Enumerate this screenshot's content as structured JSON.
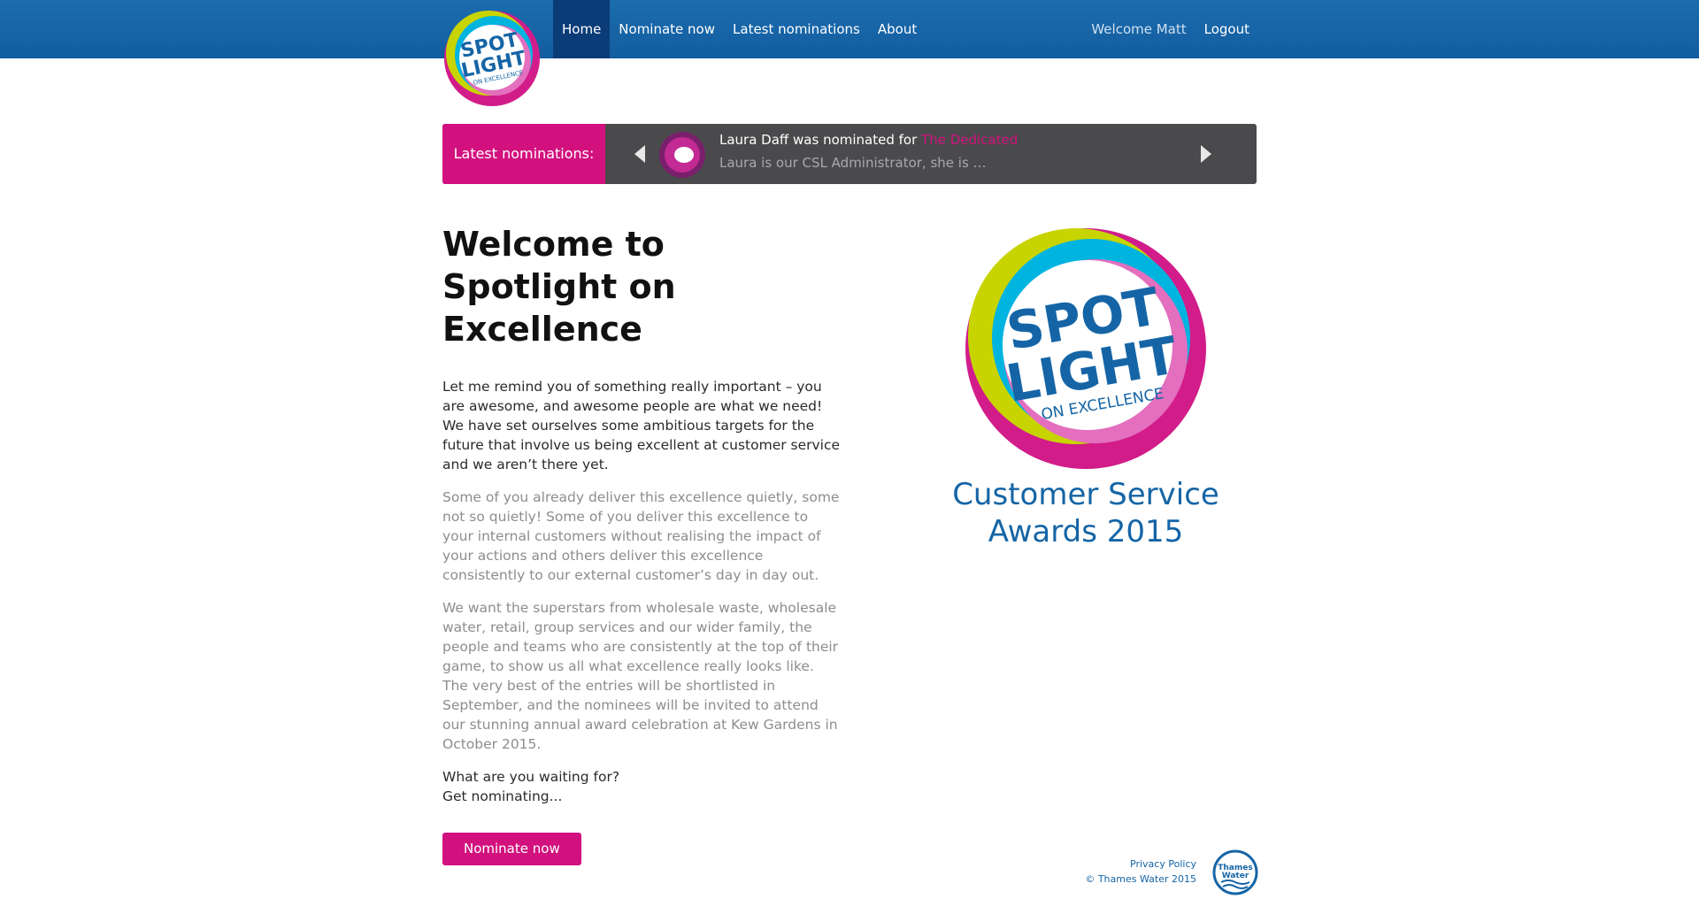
{
  "nav": {
    "items": [
      {
        "label": "Home",
        "active": true
      },
      {
        "label": "Nominate now",
        "active": false
      },
      {
        "label": "Latest nominations",
        "active": false
      },
      {
        "label": "About",
        "active": false
      }
    ],
    "welcome": "Welcome Matt",
    "logout": "Logout"
  },
  "logo": {
    "line1": "SPOT",
    "line2": "LIGHT",
    "line3": "ON EXCELLENCE"
  },
  "ticker": {
    "label": "Latest nominations:",
    "nominee_text": "Laura Daff was nominated for ",
    "award": "The Dedicated",
    "excerpt": "Laura is our CSL Administrator, she is …",
    "prev_icon": "triangle-left-icon",
    "next_icon": "triangle-right-icon"
  },
  "main": {
    "title": "Welcome to Spotlight on Excellence",
    "para1": "Let me remind you of something really important – you are awesome, and awesome people are what we need! We have set ourselves some ambitious targets for the future that involve us being excellent at customer service and we aren’t there yet.",
    "para2": "Some of you already deliver this excellence quietly, some not so quietly! Some of you deliver this excellence to your internal customers without realising the impact of your actions and others deliver this excellence consistently to our external customer’s day in day out.",
    "para3": "We want the superstars from wholesale waste, wholesale water, retail, group services and our wider family, the people and teams who are consistently at the top of their game, to show us all what excellence really looks like. The very best of the entries will be shortlisted in September, and the nominees will be invited to attend our stunning annual award celebration at Kew Gardens in October 2015.",
    "cta_line1": "What are you waiting for?",
    "cta_line2": "Get nominating...",
    "button": "Nominate now"
  },
  "hero": {
    "caption_line1": "Customer Service",
    "caption_line2": "Awards 2015"
  },
  "footer": {
    "privacy": "Privacy Policy",
    "copyright": "© Thames Water 2015",
    "brand_line1": "Thames",
    "brand_line2": "Water"
  },
  "colors": {
    "nav_blue": "#1c6cae",
    "nav_active": "#0c3c78",
    "magenta": "#d2117e",
    "ticker_bg": "#4a4a4c",
    "text_blue": "#1565a6"
  }
}
